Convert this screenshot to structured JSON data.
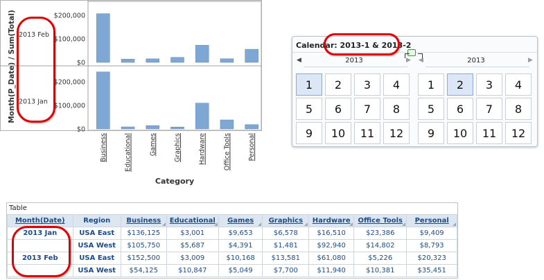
{
  "chart_data": {
    "type": "bar",
    "xlabel": "Category",
    "ylabel": "Month(P_Date) / Sum(Total)",
    "categories": [
      "Business",
      "Educational",
      "Games",
      "Graphics",
      "Hardware",
      "Office Tools",
      "Personal"
    ],
    "ylim": [
      0,
      200000
    ],
    "yticks": [
      "$0",
      "$100,000",
      "$200,000"
    ],
    "panels": [
      {
        "label": "2013 Feb",
        "values": [
          206625,
          13856,
          15217,
          21281,
          73028,
          15607,
          55658
        ]
      },
      {
        "label": "2013 Jan",
        "values": [
          241875,
          8688,
          14044,
          8059,
          109460,
          38188,
          18202
        ]
      }
    ],
    "colors": {
      "bar": "#7ea7d3"
    }
  },
  "calendar": {
    "title_prefix": "Calendar: ",
    "title_value": "2013-1 & 2013-2",
    "handle_icon": "resize-handle-icon",
    "panels": [
      {
        "year": "2013",
        "months": [
          "1",
          "2",
          "3",
          "4",
          "5",
          "6",
          "7",
          "8",
          "9",
          "10",
          "11",
          "12"
        ],
        "selected": "1"
      },
      {
        "year": "2013",
        "months": [
          "1",
          "2",
          "3",
          "4",
          "5",
          "6",
          "7",
          "8",
          "9",
          "10",
          "11",
          "12"
        ],
        "selected": "2"
      }
    ]
  },
  "table": {
    "title": "Table",
    "headers": [
      "Month(Date)",
      "Region",
      "Business",
      "Educational",
      "Games",
      "Graphics",
      "Hardware",
      "Office Tools",
      "Personal"
    ],
    "rows": [
      {
        "month": "2013 Jan",
        "region": "USA East",
        "values": [
          "$136,125",
          "$3,001",
          "$9,653",
          "$6,578",
          "$16,510",
          "$23,386",
          "$9,409"
        ]
      },
      {
        "month": "",
        "region": "USA West",
        "values": [
          "$105,750",
          "$5,687",
          "$4,391",
          "$1,481",
          "$92,940",
          "$14,802",
          "$8,793"
        ]
      },
      {
        "month": "2013 Feb",
        "region": "USA East",
        "values": [
          "$152,500",
          "$3,009",
          "$10,168",
          "$13,581",
          "$61,080",
          "$5,226",
          "$20,323"
        ]
      },
      {
        "month": "",
        "region": "USA West",
        "values": [
          "$54,125",
          "$10,847",
          "$5,049",
          "$7,700",
          "$11,940",
          "$10,381",
          "$35,451"
        ]
      }
    ]
  },
  "colors": {
    "highlight": "#e00000",
    "header_bg": "#dce6f1",
    "link": "#1a4b8a"
  }
}
